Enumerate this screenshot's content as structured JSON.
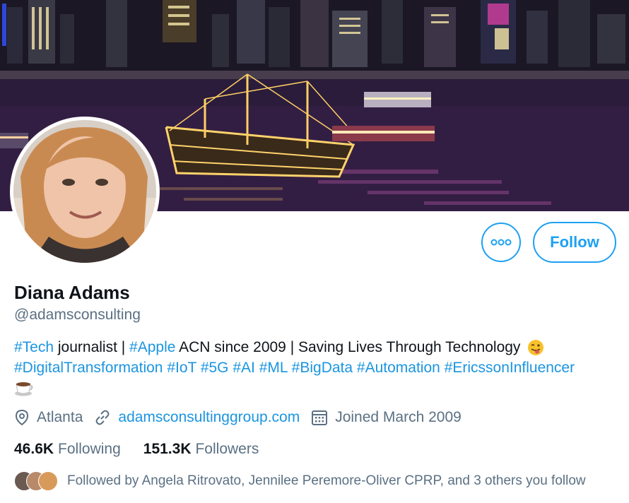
{
  "profile": {
    "name": "Diana Adams",
    "handle": "@adamsconsulting",
    "bio_line1": {
      "tag1": "#Tech",
      "text1": " journalist | ",
      "tag2": "#Apple",
      "text2": " ACN since 2009 | Saving Lives Through Technology "
    },
    "bio_line2_tags": [
      "#DigitalTransformation",
      "#IoT",
      "#5G",
      "#AI",
      "#ML",
      "#BigData",
      "#Automation",
      "#EricssonInfluencer"
    ],
    "location": "Atlanta",
    "website": "adamsconsultinggroup.com",
    "joined": "Joined March 2009"
  },
  "stats": {
    "following_count": "46.6K",
    "following_label": "Following",
    "followers_count": "151.3K",
    "followers_label": "Followers"
  },
  "followed_by": "Followed by Angela Ritrovato, Jennilee Peremore-Oliver CPRP, and 3 others you follow",
  "actions": {
    "follow_label": "Follow"
  },
  "colors": {
    "accent": "#1da1f2",
    "link": "#1b95e0",
    "secondary_text": "#5b7083"
  },
  "icons": [
    "more-icon",
    "location-icon",
    "link-icon",
    "calendar-icon",
    "winking-tongue-emoji",
    "coffee-emoji"
  ]
}
